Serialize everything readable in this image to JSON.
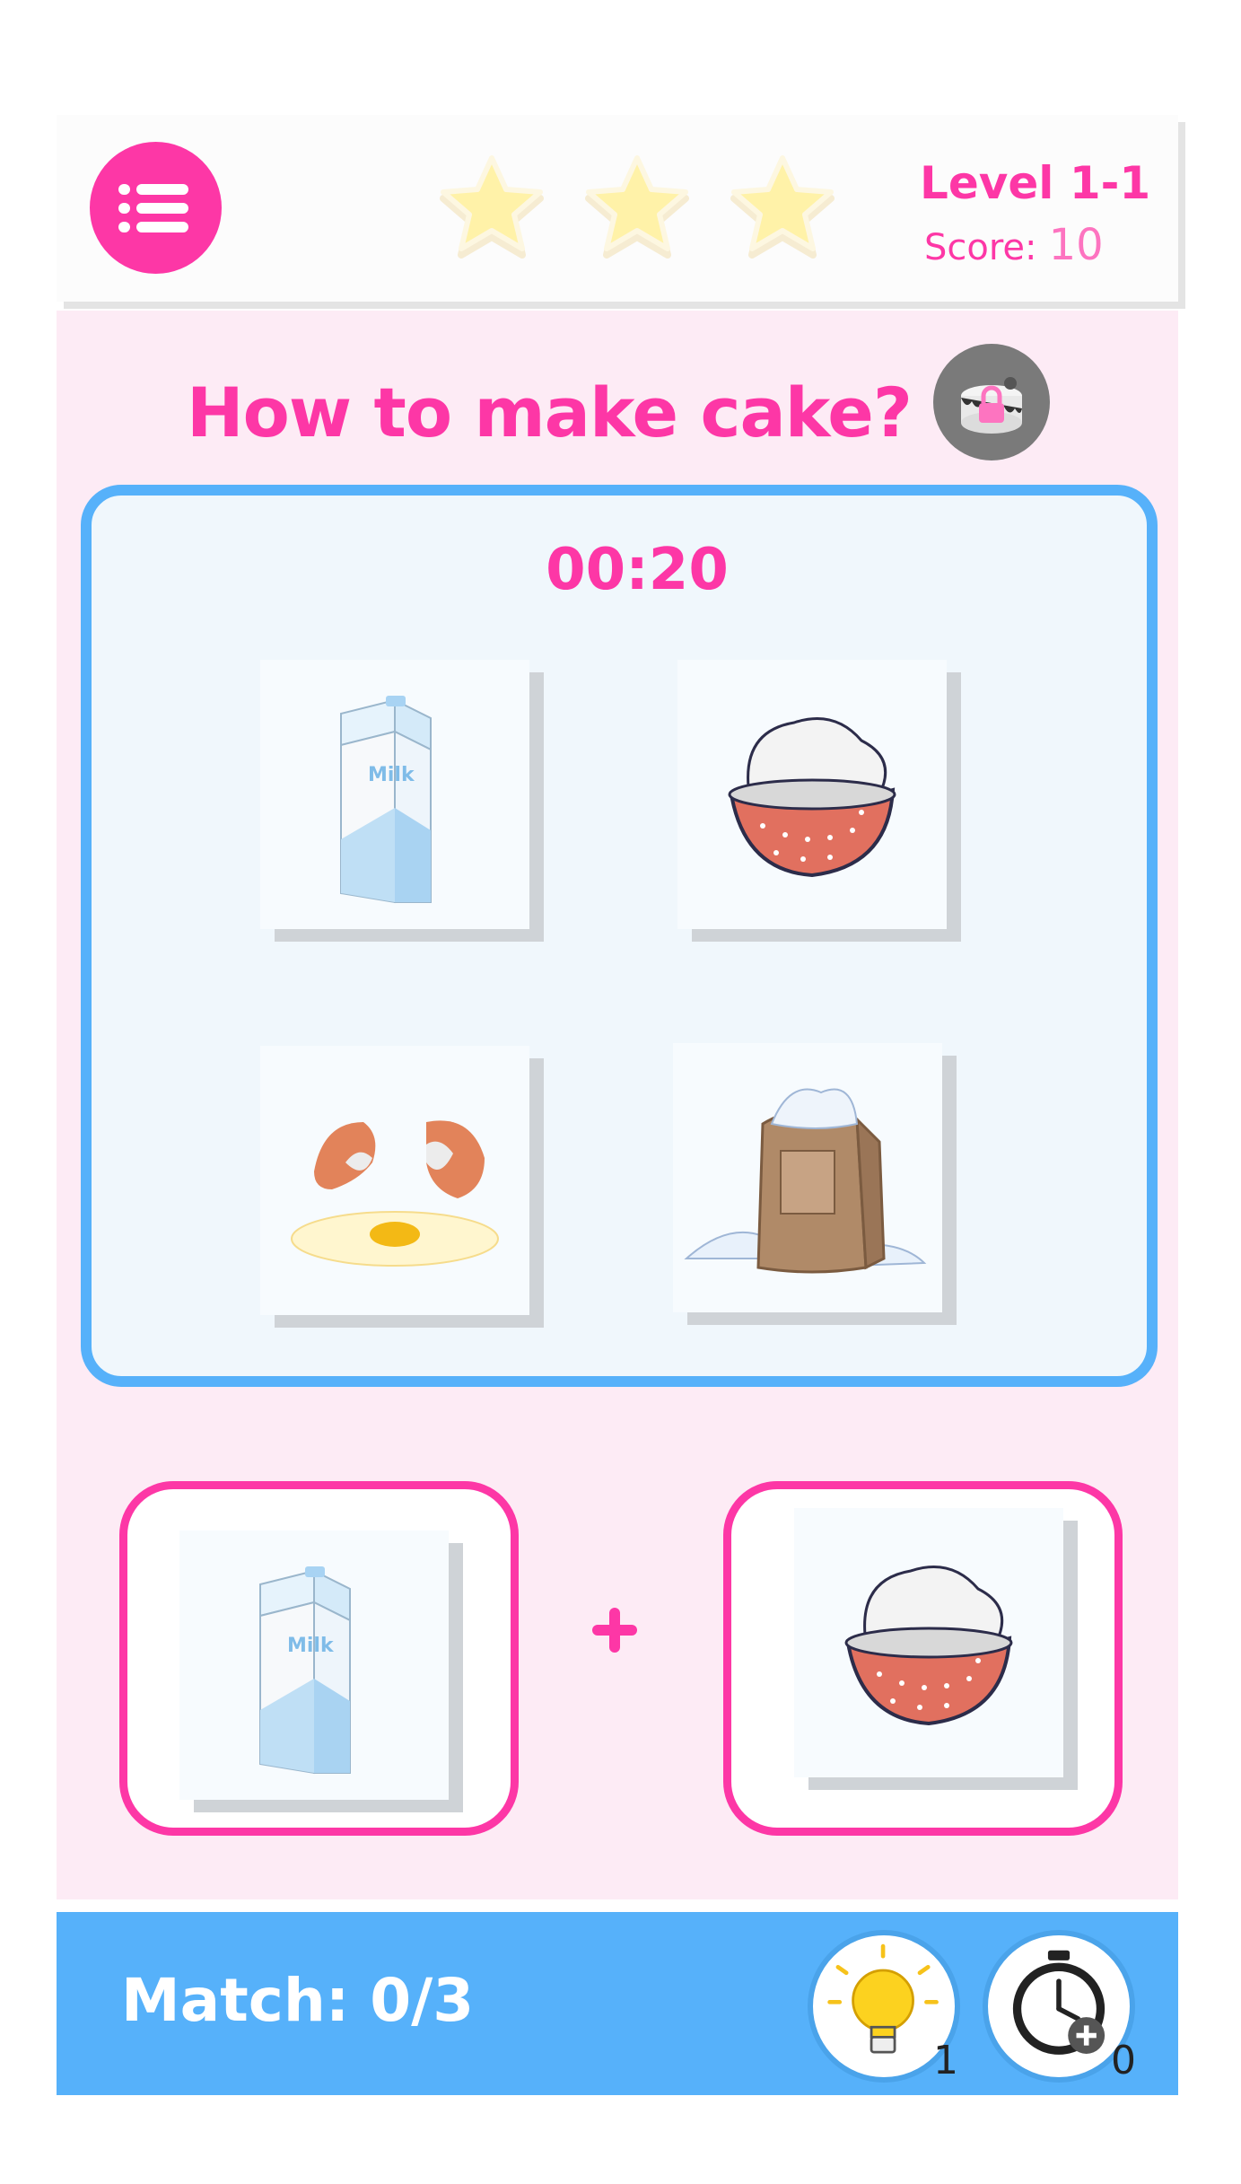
{
  "header": {
    "menu_icon": "list-menu-icon",
    "stars_earned": 3,
    "stars_total": 3,
    "level_label": "Level 1-1",
    "score_label": "Score:",
    "score_value": "10"
  },
  "question": {
    "title": "How to make cake?",
    "locked_recipe_icon": "locked-cake-icon"
  },
  "timer": "00:20",
  "cards": [
    {
      "item": "milk",
      "icon": "milk-carton-icon",
      "label": "Milk"
    },
    {
      "item": "sugar-bowl",
      "icon": "sugar-bowl-icon"
    },
    {
      "item": "eggs",
      "icon": "cracked-egg-icon"
    },
    {
      "item": "flour",
      "icon": "flour-sack-icon"
    }
  ],
  "selected_slots": [
    {
      "item": "milk",
      "icon": "milk-carton-icon",
      "label": "Milk"
    },
    {
      "item": "sugar-bowl",
      "icon": "sugar-bowl-icon"
    }
  ],
  "combine_symbol": "plus-icon",
  "footer": {
    "match_label": "Match: 0/3",
    "hint": {
      "icon": "lightbulb-icon",
      "count": "1"
    },
    "time_boost": {
      "icon": "stopwatch-plus-icon",
      "count": "0"
    }
  },
  "colors": {
    "accent_pink": "#fd37a6",
    "panel_blue": "#56b1fa",
    "play_bg": "#fdebf5",
    "star_yellow": "#fff2a8"
  }
}
